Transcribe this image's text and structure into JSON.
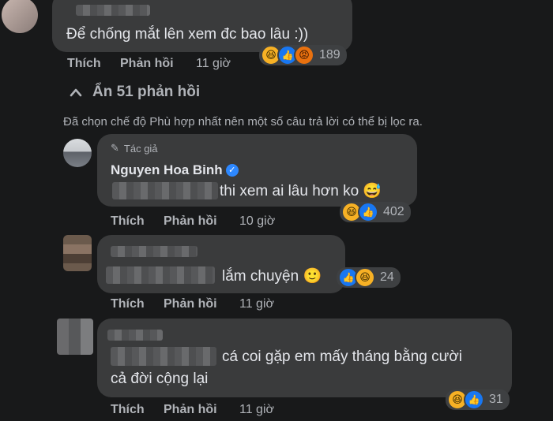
{
  "comments": [
    {
      "text": "Để chống mắt lên xem đc bao lâu :))",
      "like_label": "Thích",
      "reply_label": "Phản hồi",
      "time": "11 giờ",
      "reactions": [
        "haha",
        "like",
        "angry"
      ],
      "reaction_count": "189"
    }
  ],
  "hidden_replies": {
    "label": "Ẩn 51 phản hồi",
    "icon": "chevron-up-icon"
  },
  "filter_notice": "Đã chọn chế độ Phù hợp nhất nên một số câu trả lời có thể bị lọc ra.",
  "replies": [
    {
      "author_badge": "Tác giả",
      "author": "Nguyen Hoa Binh",
      "verified": true,
      "text": "thi xem ai lâu hơn ko 😅",
      "like_label": "Thích",
      "reply_label": "Phản hồi",
      "time": "10 giờ",
      "reactions": [
        "haha",
        "like"
      ],
      "reaction_count": "402"
    },
    {
      "text": "lắm chuyện 🙂",
      "like_label": "Thích",
      "reply_label": "Phản hồi",
      "time": "11 giờ",
      "reactions": [
        "like",
        "haha"
      ],
      "reaction_count": "24"
    },
    {
      "text_line1": "cá coi gặp em mấy tháng bằng cười",
      "text_line2": "cả đời cộng lại",
      "like_label": "Thích",
      "reply_label": "Phản hồi",
      "time": "11 giờ",
      "reactions": [
        "haha",
        "like"
      ],
      "reaction_count": "31"
    }
  ],
  "colors": {
    "background": "#18191a",
    "bubble": "#3a3b3c",
    "secondary_text": "#b0b3b8",
    "like_blue": "#1877f2",
    "haha_yellow": "#f7b125"
  }
}
